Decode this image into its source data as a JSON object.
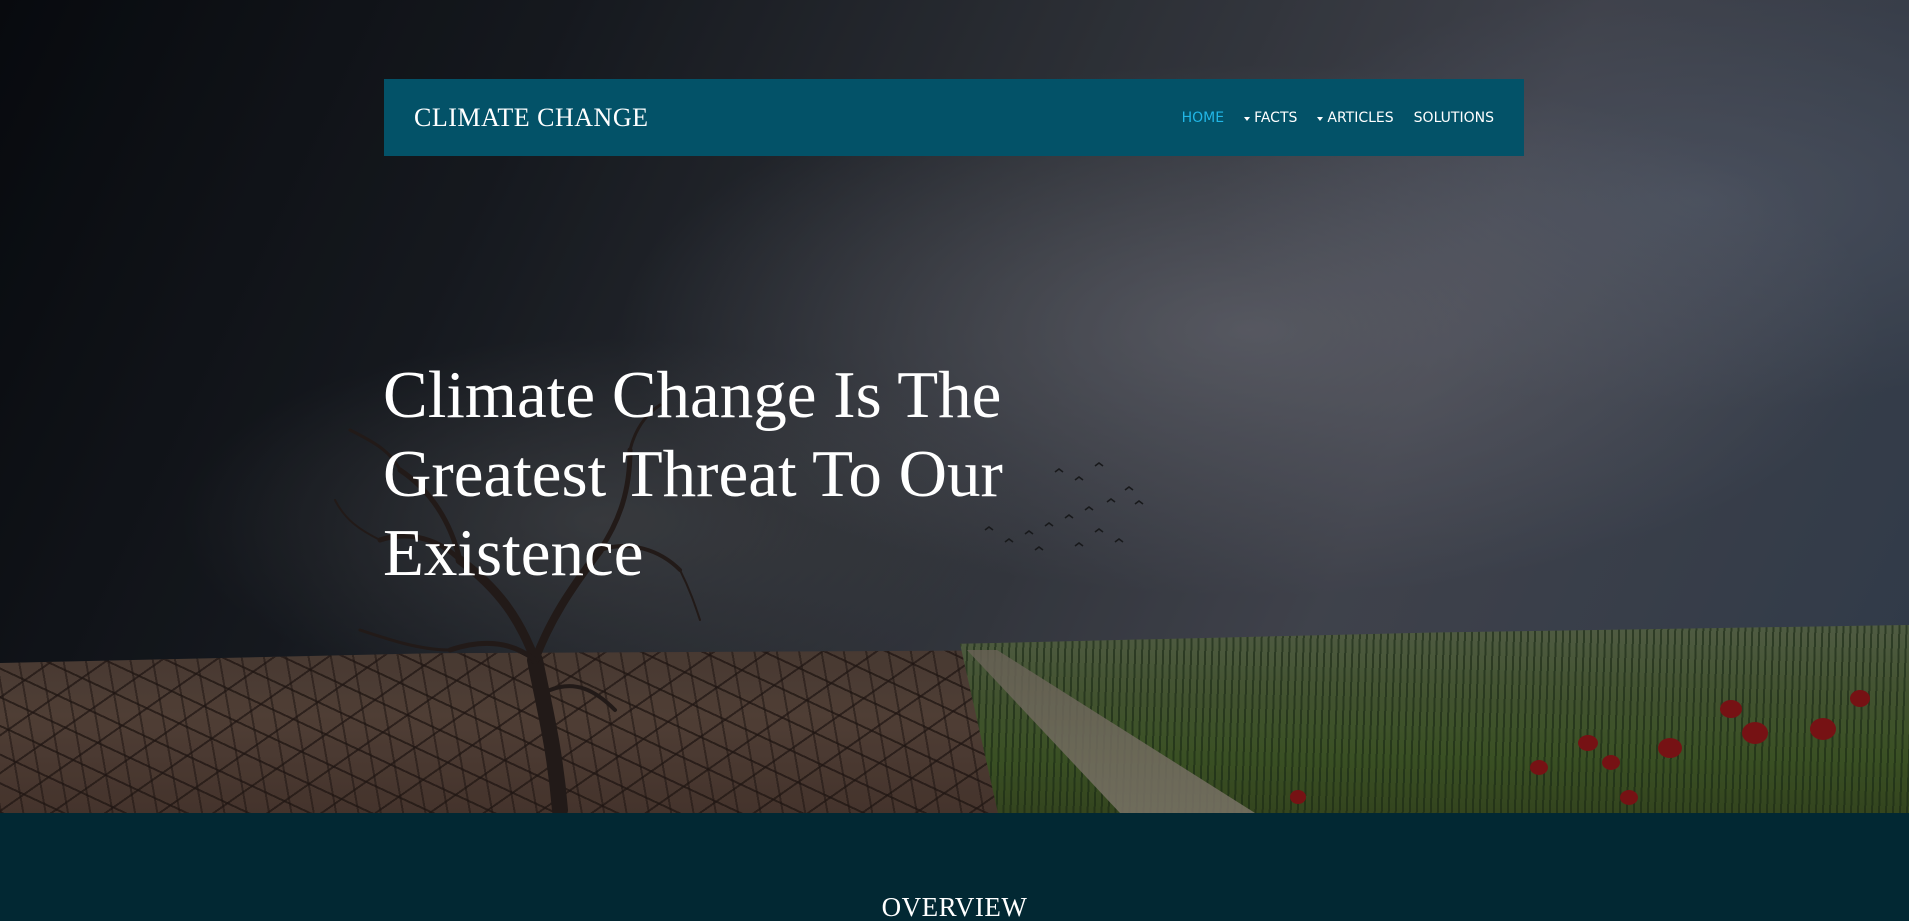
{
  "brand": {
    "name": "CLIMATE CHANGE"
  },
  "nav": {
    "items": [
      {
        "label": "HOME",
        "active": true,
        "has_dropdown": false
      },
      {
        "label": "FACTS",
        "active": false,
        "has_dropdown": true
      },
      {
        "label": "ARTICLES",
        "active": false,
        "has_dropdown": true
      },
      {
        "label": "SOLUTIONS",
        "active": false,
        "has_dropdown": false
      }
    ]
  },
  "hero": {
    "title": "Climate Change Is The Greatest Threat To Our Existence"
  },
  "overview": {
    "heading": "OVERVIEW"
  },
  "colors": {
    "navbar_bg": "#035268",
    "nav_active": "#21b6e6",
    "section_bg": "#022833",
    "text": "#ffffff"
  }
}
